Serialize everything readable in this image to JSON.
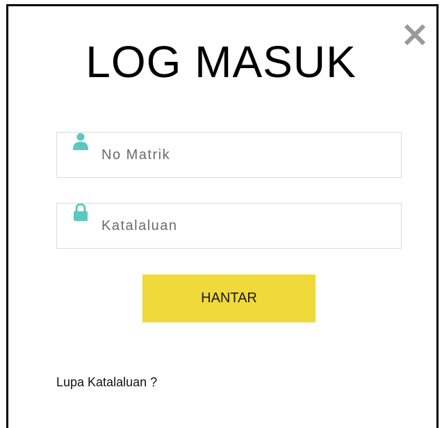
{
  "dialog": {
    "title": "LOG MASUK",
    "close_icon": "close-icon"
  },
  "form": {
    "username": {
      "icon": "user-icon",
      "placeholder": "No Matrik",
      "value": ""
    },
    "password": {
      "icon": "lock-icon",
      "placeholder": "Katalaluan",
      "value": ""
    },
    "submit_label": "HANTAR",
    "forgot_link": "Lupa Katalaluan ?"
  },
  "colors": {
    "accent_icon": "#5bc8c0",
    "submit_bg": "#f0d93a",
    "close_icon": "#999999",
    "modal_border": "#000000"
  }
}
